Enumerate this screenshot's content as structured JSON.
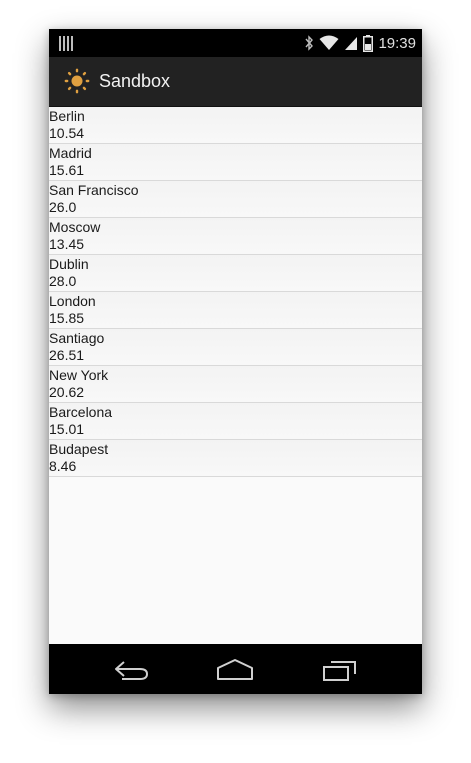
{
  "status_bar": {
    "time": "19:39",
    "icons": [
      "bluetooth-icon",
      "wifi-icon",
      "signal-icon",
      "battery-icon"
    ]
  },
  "app_bar": {
    "title": "Sandbox",
    "icon": "sun-icon",
    "icon_color": "#e0a040"
  },
  "cities": [
    {
      "name": "Berlin",
      "value": "10.54"
    },
    {
      "name": "Madrid",
      "value": "15.61"
    },
    {
      "name": "San Francisco",
      "value": "26.0"
    },
    {
      "name": "Moscow",
      "value": "13.45"
    },
    {
      "name": "Dublin",
      "value": "28.0"
    },
    {
      "name": "London",
      "value": "15.85"
    },
    {
      "name": "Santiago",
      "value": "26.51"
    },
    {
      "name": "New York",
      "value": "20.62"
    },
    {
      "name": "Barcelona",
      "value": "15.01"
    },
    {
      "name": "Budapest",
      "value": "8.46"
    }
  ],
  "nav_bar": {
    "buttons": [
      "back-icon",
      "home-icon",
      "recent-apps-icon"
    ]
  }
}
